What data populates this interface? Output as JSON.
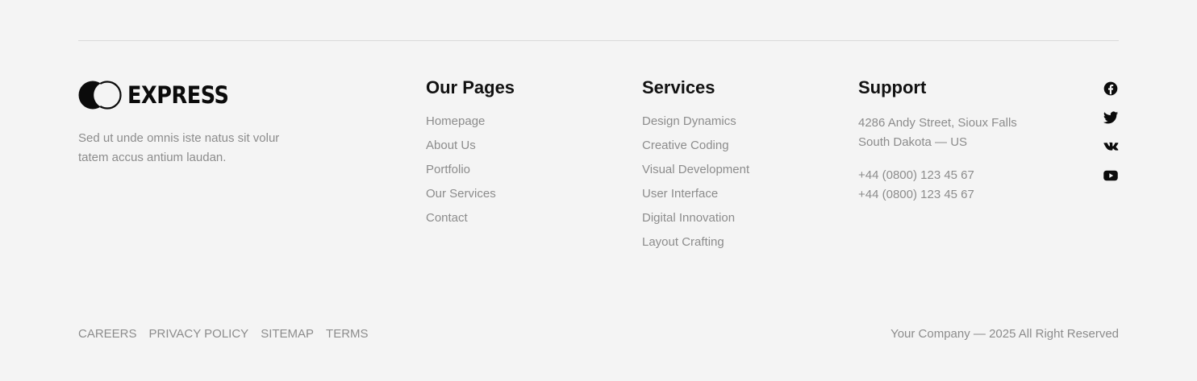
{
  "brand": {
    "name": "EXPRESS",
    "tagline": "Sed ut unde omnis iste natus sit volur tatem accus antium laudan.",
    "icon": "interlocking-circles-logo-icon"
  },
  "columns": {
    "pages": {
      "title": "Our Pages",
      "items": [
        "Homepage",
        "About Us",
        "Portfolio",
        "Our Services",
        "Contact"
      ]
    },
    "services": {
      "title": "Services",
      "items": [
        "Design Dynamics",
        "Creative Coding",
        "Visual Development",
        "User Interface",
        "Digital Innovation",
        "Layout Crafting"
      ]
    },
    "support": {
      "title": "Support",
      "address_line1": "4286 Andy Street, Sioux Falls",
      "address_line2": "South Dakota — US",
      "phone1": "+44 (0800) 123 45 67",
      "phone2": "+44 (0800) 123 45 67"
    }
  },
  "social": [
    "facebook-icon",
    "twitter-icon",
    "vk-icon",
    "youtube-icon"
  ],
  "bottom_links": [
    "CAREERS",
    "PRIVACY POLICY",
    "SITEMAP",
    "TERMS"
  ],
  "copyright": "Your Company — 2025 All Right Reserved",
  "colors": {
    "background": "#f4f4f4",
    "heading": "#111111",
    "muted_text": "#8c8c8c",
    "divider": "#d9d9d9"
  }
}
